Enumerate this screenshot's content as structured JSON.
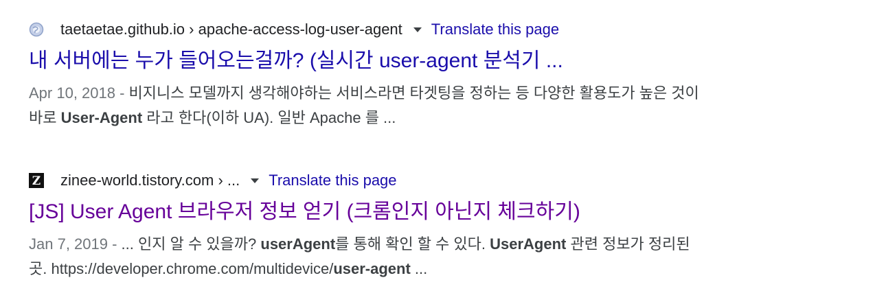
{
  "results": [
    {
      "favicon": "globe-icon",
      "site": "taetaetae.github.io",
      "breadcrumb_sep": " › ",
      "path": "apache-access-log-user-agent",
      "translate_label": "Translate this page",
      "title": "내 서버에는 누가 들어오는걸까? (실시간 user-agent 분석기 ...",
      "date": "Apr 10, 2018 - ",
      "snippet": {
        "a": "비지니스 모델까지 생각해야하는 서비스라면 타겟팅을 정하는 등 다양한 활용도가 높은 것이",
        "b": "바로 ",
        "c": "User-Agent",
        "d": " 라고 한다(이하 UA). 일반 Apache 를 ..."
      }
    },
    {
      "favicon": "z-logo-icon",
      "favicon_letter": "Z",
      "site": "zinee-world.tistory.com",
      "breadcrumb_sep": " › ",
      "path": "...",
      "translate_label": "Translate this page",
      "title": "[JS] User Agent 브라우저 정보 얻기 (크롬인지 아닌지 체크하기)",
      "date": "Jan 7, 2019 - ",
      "snippet": {
        "a": "... 인지 알 수 있을까? ",
        "b": "userAgent",
        "c": "를 통해 확인 할 수 있다. ",
        "d": "UserAgent",
        "e": " 관련 정보가 정리된",
        "f": "곳. https://developer.chrome.com/multidevice/",
        "g": "user-agent",
        "h": " ..."
      }
    }
  ]
}
